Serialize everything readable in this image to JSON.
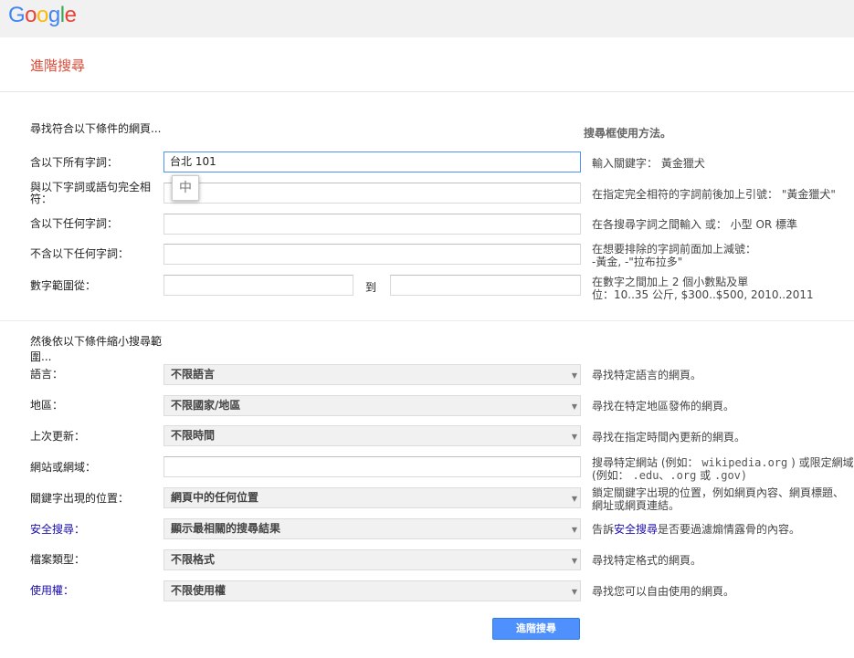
{
  "logo": {
    "text": "Google"
  },
  "page": {
    "title": "進階搜尋"
  },
  "colors": {
    "accent": "#4d90fe",
    "title_red": "#dd4b39",
    "link": "#1a0dab"
  },
  "find": {
    "heading": "尋找符合以下條件的網頁...",
    "help_heading": "搜尋框使用方法。",
    "rows": [
      {
        "label": "含以下所有字詞：",
        "value": "台北 101",
        "hint": "輸入關鍵字： 黃金獵犬"
      },
      {
        "label": "與以下字詞或語句完全相符：",
        "value": "",
        "hint": "在指定完全相符的字詞前後加上引號： \"黃金獵犬\""
      },
      {
        "label": "含以下任何字詞：",
        "value": "",
        "hint": "在各搜尋字詞之間輸入 或： 小型 OR 標準"
      },
      {
        "label": "不含以下任何字詞：",
        "value": "",
        "hint_line1": "在想要排除的字詞前面加上減號：",
        "hint_line2": "-黃金, -\"拉布拉多\""
      },
      {
        "label": "數字範圍從：",
        "from": "",
        "to_label": "到",
        "to": "",
        "hint_line1": "在數字之間加上 2 個小數點及單",
        "hint_line2": "位：10..35 公斤, $300..$500, 2010..2011"
      }
    ],
    "ime_char": "中"
  },
  "narrow": {
    "heading": "然後依以下條件縮小搜尋範圍...",
    "language": {
      "label": "語言：",
      "selected": "不限語言",
      "hint": "尋找特定語言的網頁。"
    },
    "region": {
      "label": "地區：",
      "selected": "不限國家/地區",
      "hint": "尋找在特定地區發佈的網頁。"
    },
    "last_update": {
      "label": "上次更新：",
      "selected": "不限時間",
      "hint": "尋找在指定時間內更新的網頁。"
    },
    "site": {
      "label": "網站或網域：",
      "value": "",
      "hint_line1_pre": "搜尋特定網站 (例如：",
      "hint_line1_mono": "wikipedia.org",
      "hint_line1_post": ") 或限定網域",
      "hint_line2_pre": "(例如：",
      "hint_line2_mono": ".edu、.org",
      "hint_line2_mid": "或",
      "hint_line2_mono2": ".gov)"
    },
    "terms_appear": {
      "label": "關鍵字出現的位置：",
      "selected": "網頁中的任何位置",
      "hint": "鎖定關鍵字出現的位置，例如網頁內容、網頁標題、網址或網頁連結。"
    },
    "safesearch": {
      "label": "安全搜尋：",
      "selected": "顯示最相關的搜尋結果",
      "hint_pre": "告訴",
      "hint_link": "安全搜尋",
      "hint_post": "是否要過濾煽情露骨的內容。"
    },
    "file_type": {
      "label": "檔案類型：",
      "selected": "不限格式",
      "hint": "尋找特定格式的網頁。"
    },
    "usage_rights": {
      "label": "使用權：",
      "selected": "不限使用權",
      "hint": "尋找您可以自由使用的網頁。"
    }
  },
  "submit": {
    "label": "進階搜尋"
  }
}
